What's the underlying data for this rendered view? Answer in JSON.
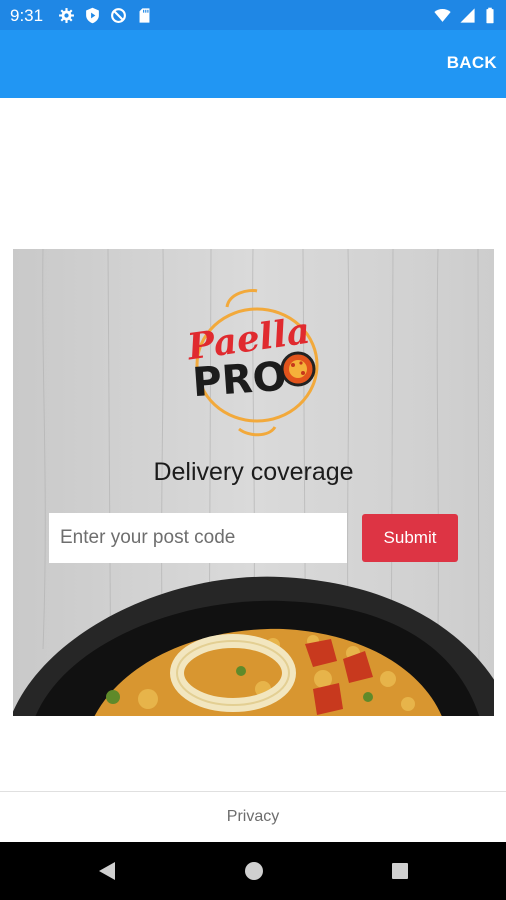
{
  "status_bar": {
    "time": "9:31",
    "left_icons": [
      "gear-icon",
      "play-protect-icon",
      "data-saver-icon",
      "sd-card-icon"
    ],
    "right_icons": [
      "wifi-icon",
      "signal-icon",
      "battery-icon"
    ]
  },
  "app_bar": {
    "back_label": "BACK",
    "color": "#2196f3"
  },
  "hero": {
    "logo_text_top": "Paella",
    "logo_text_bottom": "PRO",
    "title": "Delivery coverage",
    "postcode": {
      "value": "",
      "placeholder": "Enter your post code"
    },
    "submit_label": "Submit",
    "submit_color": "#dd3444"
  },
  "footer": {
    "privacy_label": "Privacy"
  },
  "nav_bar": {
    "buttons": [
      "back-triangle-icon",
      "home-circle-icon",
      "recents-square-icon"
    ]
  }
}
